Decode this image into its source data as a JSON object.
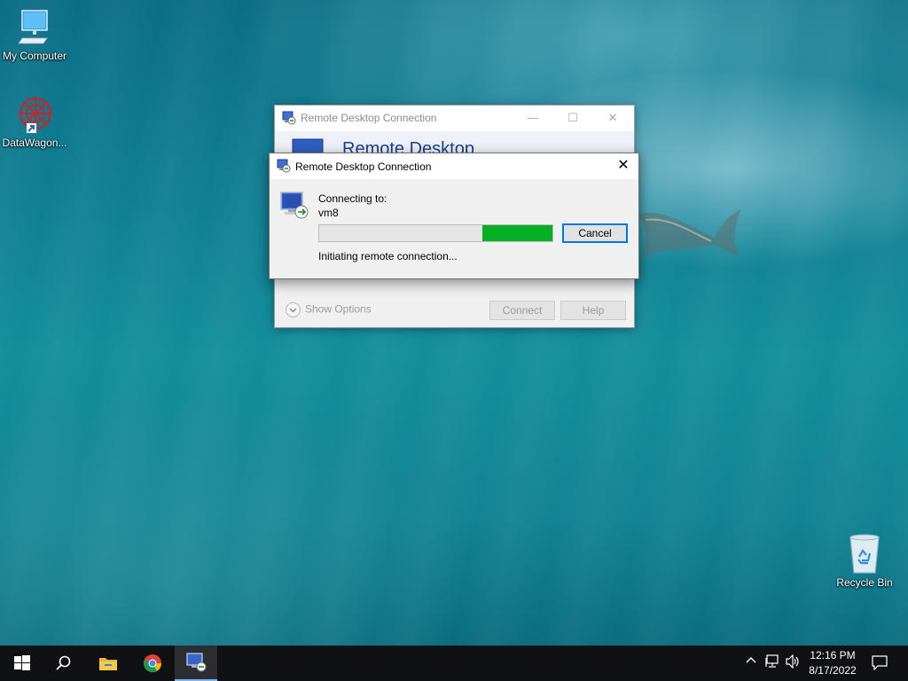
{
  "desktop": {
    "icons": [
      {
        "label": "My Computer"
      },
      {
        "label": "DataWagon..."
      },
      {
        "label": "Recycle Bin"
      }
    ]
  },
  "background_window": {
    "title": "Remote Desktop Connection",
    "banner": "Remote Desktop",
    "show_options": "Show Options",
    "connect_label": "Connect",
    "help_label": "Help"
  },
  "dialog": {
    "title": "Remote Desktop Connection",
    "connecting_label": "Connecting to:",
    "host": "vm8",
    "status": "Initiating remote connection...",
    "cancel_label": "Cancel",
    "progress": {
      "fill_start": 0.7,
      "fill_end": 1.0,
      "color": "#06b025"
    }
  },
  "taskbar": {
    "apps": [
      "start-icon",
      "search-icon",
      "file-explorer-icon",
      "chrome-icon",
      "remote-desktop-icon"
    ],
    "clock": {
      "time": "12:16 PM",
      "date": "8/17/2022"
    }
  },
  "colors": {
    "accent": "#0078d7",
    "title_blue": "#1c3f8c"
  }
}
